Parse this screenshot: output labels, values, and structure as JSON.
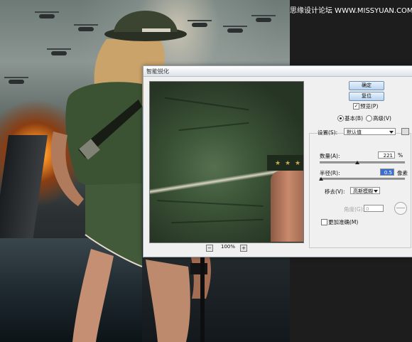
{
  "watermark": "思缘设计论坛  WWW.MISSYUAN.COM",
  "dialog": {
    "title": "智能锐化",
    "ok_label": "确定",
    "reset_label": "复位",
    "preview_label": "预览(P)",
    "preview_checked": true,
    "mode": {
      "basic_label": "基本(B)",
      "advanced_label": "高级(V)",
      "selected": "basic"
    },
    "settings": {
      "label": "设置(S):",
      "value": "默认值"
    },
    "amount": {
      "label": "数量(A):",
      "value": "221",
      "unit": "%",
      "fraction": 0.44
    },
    "radius": {
      "label": "半径(R):",
      "value": "0.5",
      "unit": "像素",
      "fraction": 0.02
    },
    "remove": {
      "label": "移去(V):",
      "value": "高斯模糊"
    },
    "angle": {
      "label": "角度(G):",
      "value": "0"
    },
    "more_accurate": {
      "label": "更加准确(M)",
      "checked": false
    },
    "zoom": {
      "value": "100%",
      "minus": "−",
      "plus": "+"
    }
  },
  "colors": {
    "dialog_bg": "#f0f0f0",
    "button_blue": "#b9d3ee",
    "uniform_green": "#3c5437"
  }
}
